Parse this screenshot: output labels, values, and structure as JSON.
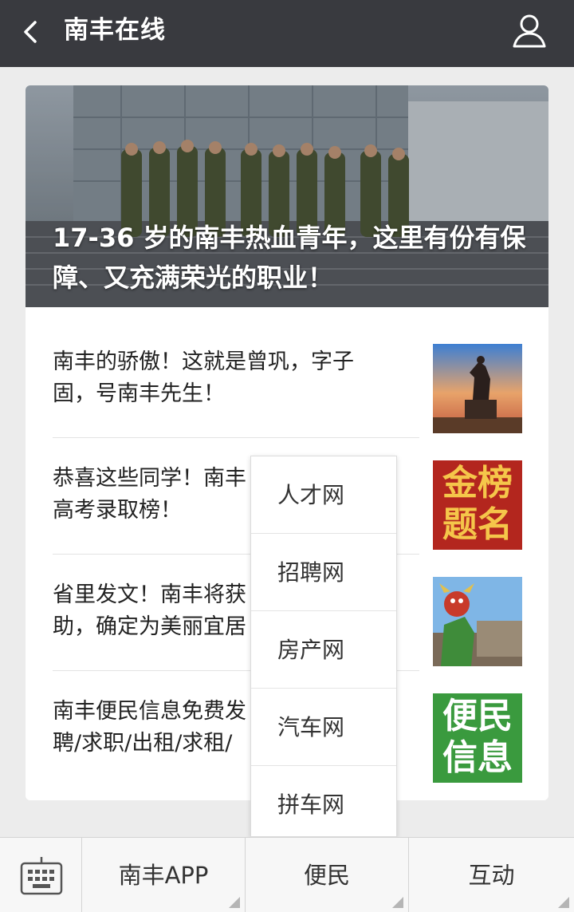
{
  "header": {
    "title": "南丰在线"
  },
  "hero": {
    "caption_lines": [
      "17-36 岁的南丰热血青年，这里有份有保",
      "障、又充满荣光的职业！"
    ]
  },
  "articles": [
    {
      "lines": [
        "南丰的骄傲！这就是曾巩，字子",
        "固，号南丰先生！"
      ],
      "thumb_icon": "statue-photo"
    },
    {
      "lines": [
        "恭喜这些同学！南丰",
        "高考录取榜！"
      ],
      "thumb_icon": "jinbang-timing-poster",
      "thumb_text": [
        "金榜",
        "题名"
      ]
    },
    {
      "lines": [
        "省里发文！南丰将获",
        "助，确定为美丽宜居"
      ],
      "thumb_icon": "nuo-mask-photo"
    },
    {
      "lines": [
        "南丰便民信息免费发",
        "聘/求职/出租/求租/"
      ],
      "thumb_icon": "bianmin-info-poster",
      "thumb_text": [
        "便民",
        "信息"
      ]
    }
  ],
  "popup_menu": {
    "items": [
      "人才网",
      "招聘网",
      "房产网",
      "汽车网",
      "拼车网"
    ]
  },
  "bottom_menu": {
    "keyboard_icon": "keyboard-icon",
    "items": [
      "南丰APP",
      "便民",
      "互动"
    ]
  }
}
